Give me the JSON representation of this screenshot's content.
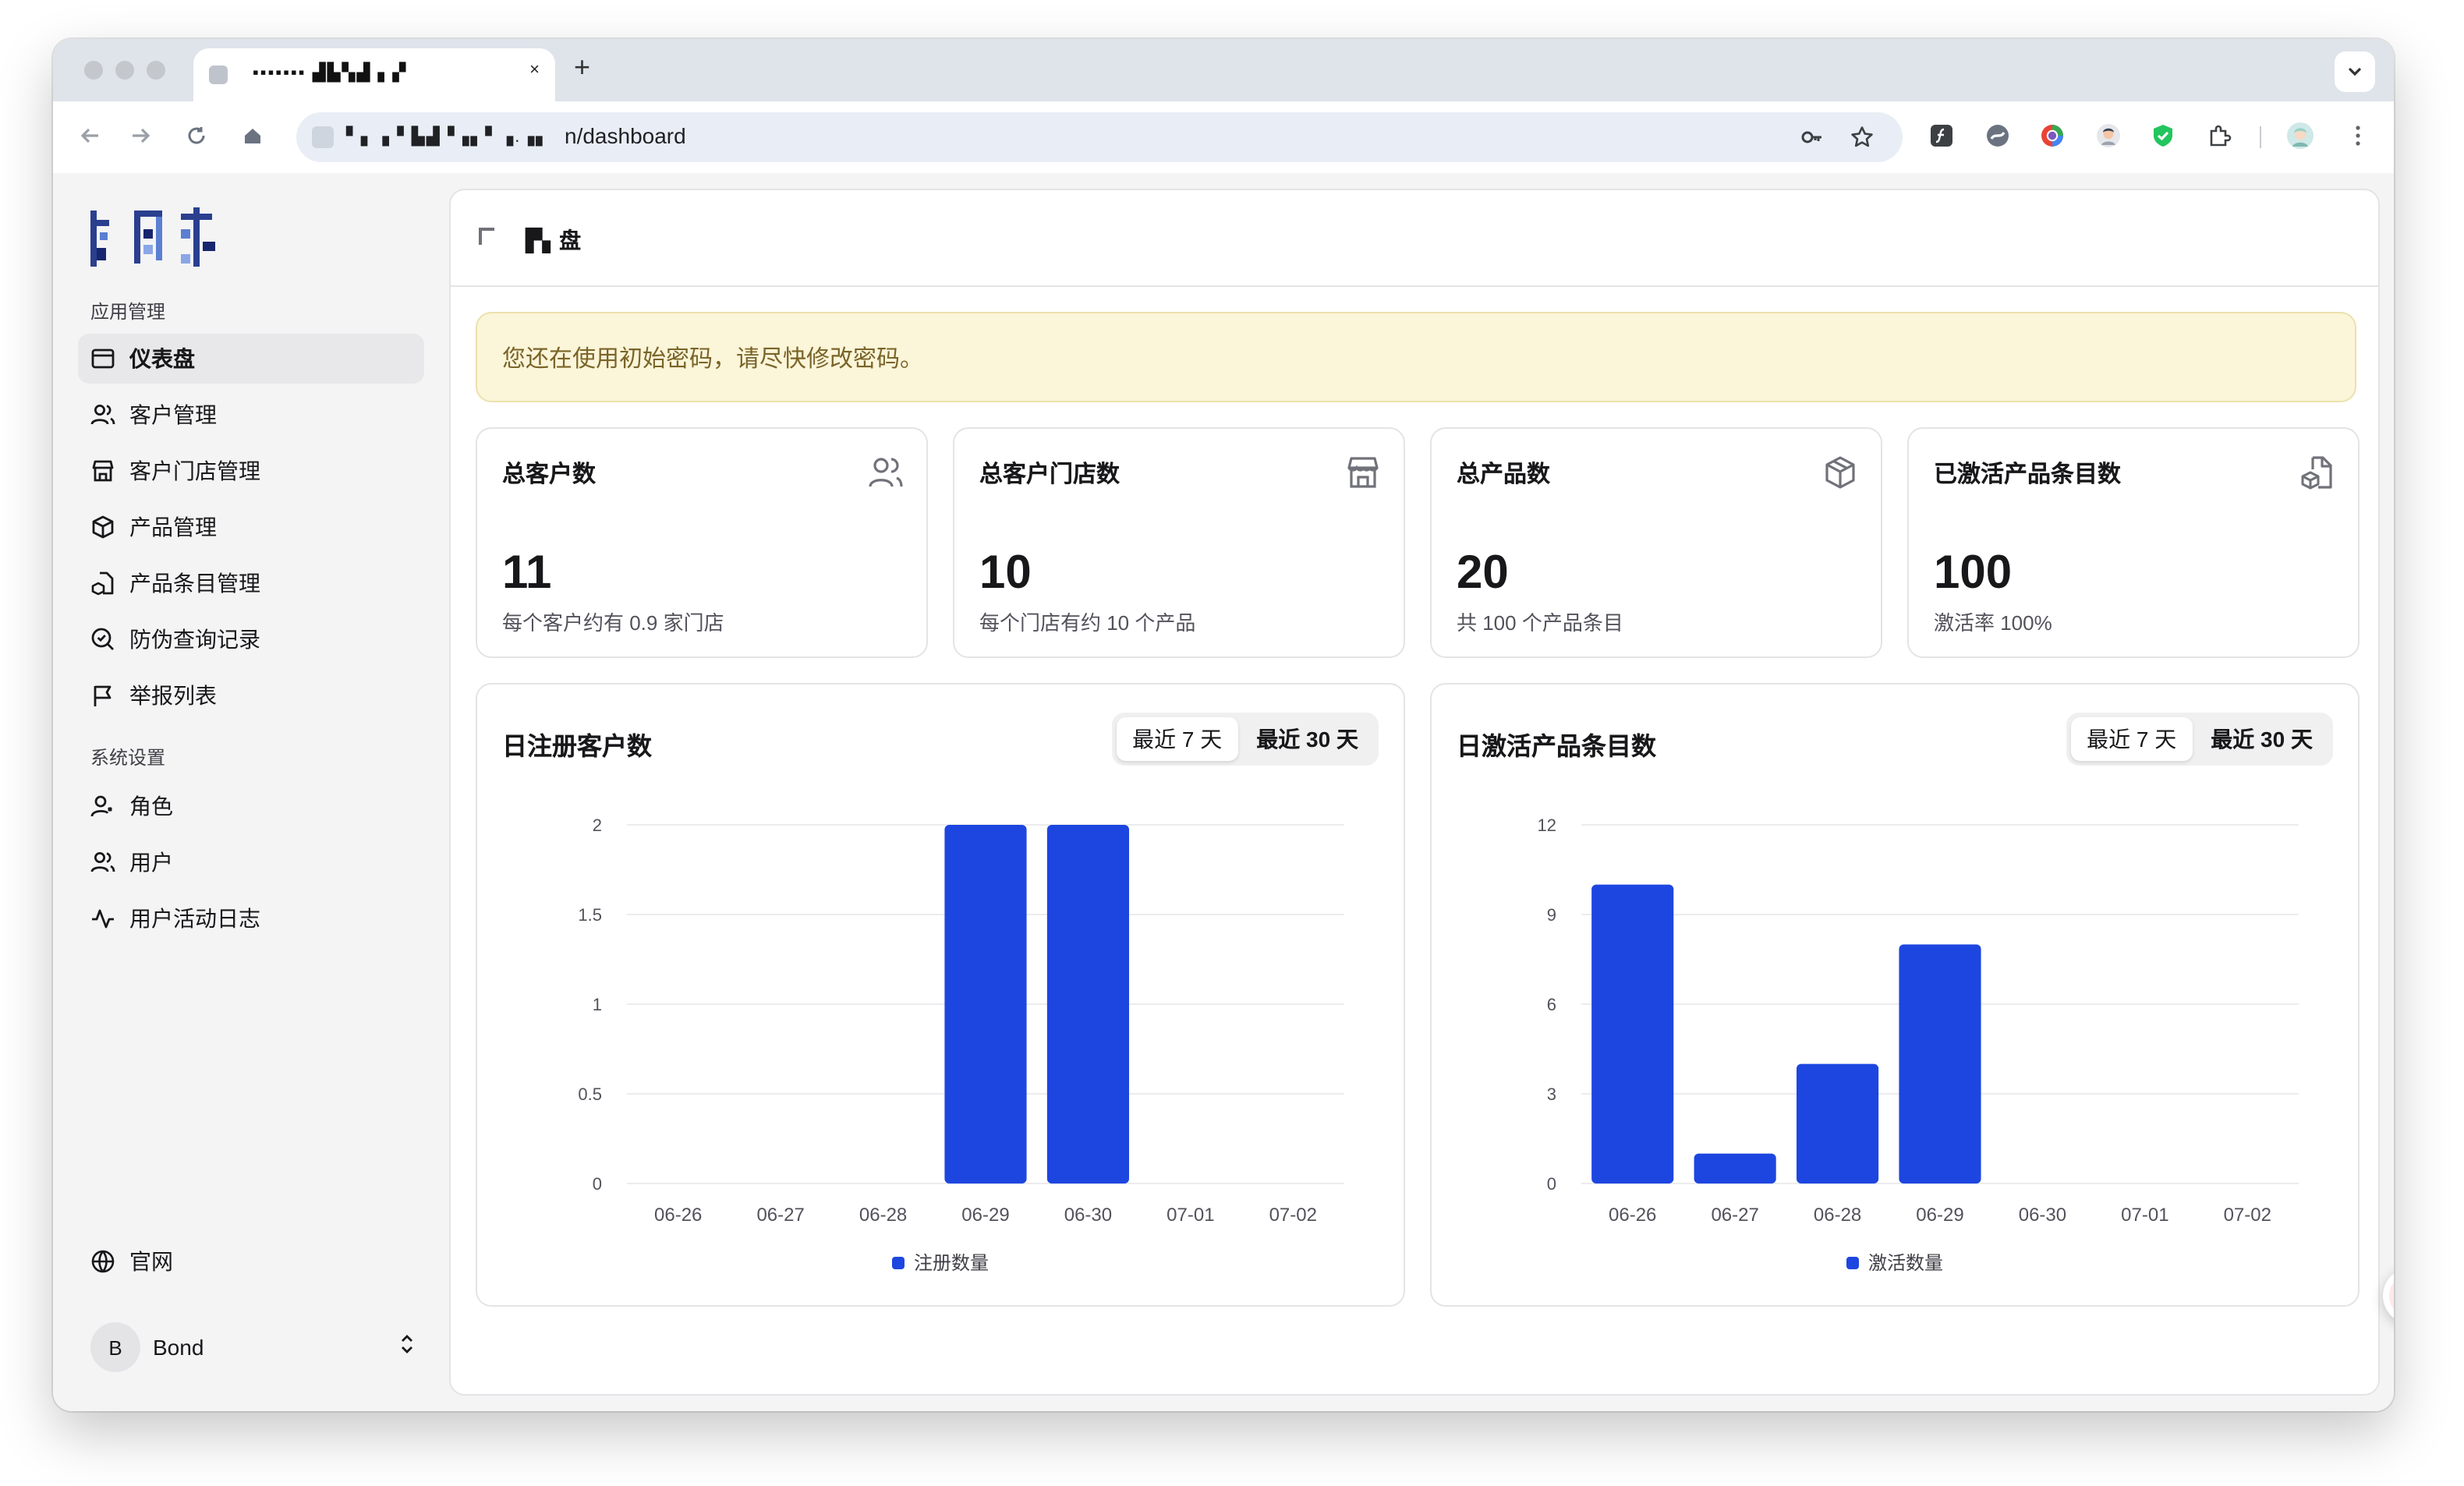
{
  "browser": {
    "tab_title": "▪▪▪▪▪▪▪ ▟▙▚▟ ▖▞",
    "tab_close": "×",
    "new_tab": "+",
    "url_host": "▘▖▗▝ ▙▟▝▗▖▘▗.▗▖",
    "url_path": "n/dashboard"
  },
  "sidebar": {
    "logo_text": "▛▚▟",
    "section_app": "应用管理",
    "app_items": [
      {
        "label": "仪表盘",
        "icon": "dashboard-icon",
        "active": true
      },
      {
        "label": "客户管理",
        "icon": "users-icon"
      },
      {
        "label": "客户门店管理",
        "icon": "store-icon"
      },
      {
        "label": "产品管理",
        "icon": "box-icon"
      },
      {
        "label": "产品条目管理",
        "icon": "package-file-icon"
      },
      {
        "label": "防伪查询记录",
        "icon": "search-check-icon"
      },
      {
        "label": "举报列表",
        "icon": "flag-icon"
      }
    ],
    "section_system": "系统设置",
    "system_items": [
      {
        "label": "角色",
        "icon": "user-role-icon"
      },
      {
        "label": "用户",
        "icon": "users-icon"
      },
      {
        "label": "用户活动日志",
        "icon": "activity-icon"
      }
    ],
    "website_label": "官网",
    "user": {
      "initial": "B",
      "name": "Bond"
    }
  },
  "header": {
    "title": "▛▖盘"
  },
  "alert": {
    "text": "您还在使用初始密码，请尽快修改密码。"
  },
  "stats": [
    {
      "title": "总客户数",
      "value": "11",
      "subtitle": "每个客户约有 0.9 家门店",
      "icon": "users-icon"
    },
    {
      "title": "总客户门店数",
      "value": "10",
      "subtitle": "每个门店有约 10 个产品",
      "icon": "store-icon"
    },
    {
      "title": "总产品数",
      "value": "20",
      "subtitle": "共 100 个产品条目",
      "icon": "box-icon"
    },
    {
      "title": "已激活产品条目数",
      "value": "100",
      "subtitle": "激活率 100%",
      "icon": "package-file-icon"
    }
  ],
  "ranges": {
    "last7": "最近 7 天",
    "last30": "最近 30 天"
  },
  "colors": {
    "bar": "#1d46e0",
    "alert_bg": "#fbf5d9",
    "alert_text": "#7a6428"
  },
  "chart_data": [
    {
      "type": "bar",
      "title": "日注册客户数",
      "categories": [
        "06-26",
        "06-27",
        "06-28",
        "06-29",
        "06-30",
        "07-01",
        "07-02"
      ],
      "series": [
        {
          "name": "注册数量",
          "values": [
            0,
            0,
            0,
            2,
            2,
            0,
            0
          ]
        }
      ],
      "ylim": [
        0,
        2
      ],
      "yticks": [
        0,
        0.5,
        1,
        1.5,
        2
      ],
      "grid": true,
      "legend": "bottom"
    },
    {
      "type": "bar",
      "title": "日激活产品条目数",
      "categories": [
        "06-26",
        "06-27",
        "06-28",
        "06-29",
        "06-30",
        "07-01",
        "07-02"
      ],
      "series": [
        {
          "name": "激活数量",
          "values": [
            10,
            1,
            4,
            8,
            0,
            0,
            0
          ]
        }
      ],
      "ylim": [
        0,
        12
      ],
      "yticks": [
        0,
        3,
        6,
        9,
        12
      ],
      "grid": true,
      "legend": "bottom"
    }
  ]
}
